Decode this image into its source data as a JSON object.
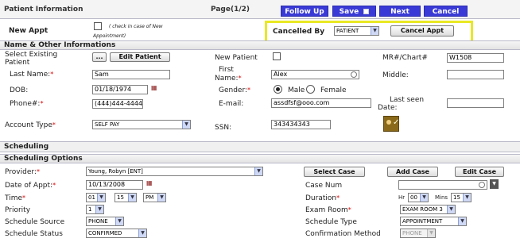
{
  "header": {
    "title": "Patient Information",
    "page": "Page(1/2)",
    "buttons": {
      "follow_up": "Follow Up",
      "save": "Save",
      "next": "Next",
      "cancel": "Cancel"
    },
    "save_icon": "floppy-icon"
  },
  "new_appt": {
    "label": "New Appt",
    "note_line1": "( check in case of New",
    "note_line2": "Appointment)"
  },
  "cancelled_by": {
    "label": "Cancelled By",
    "value": "PATIENT",
    "button": "Cancel Appt"
  },
  "sections": {
    "name_other": "Name & Other Informations",
    "scheduling": "Scheduling",
    "scheduling_options": "Scheduling Options"
  },
  "patient": {
    "select_existing_label": "Select Existing Patient",
    "dots": "...",
    "edit_patient": "Edit Patient",
    "new_patient_label": "New Patient",
    "mr_chart_label": "MR#/Chart#",
    "mr_chart_value": "W1508",
    "last_name_label": "Last Name:",
    "last_name_value": "Sam",
    "first_name_label_1": "First",
    "first_name_label_2": "Name:",
    "first_name_value": "Alex",
    "middle_label": "Middle:",
    "middle_value": "",
    "dob_label": "DOB:",
    "dob_value": "01/18/1974",
    "gender_label": "Gender:",
    "gender_male": "Male",
    "gender_female": "Female",
    "phone_label": "Phone#:",
    "phone_value": "(444)444-4444",
    "email_label": "E-mail:",
    "email_value": "assdfsf@ooo.com",
    "last_seen_label_1": "Last seen",
    "last_seen_label_2": "Date:",
    "last_seen_value": "",
    "account_type_label": "Account Type",
    "account_type_value": "SELF PAY",
    "ssn_label": "SSN:",
    "ssn_value": "343434343"
  },
  "scheduling": {
    "provider_label": "Provider:",
    "provider_value": "Young, Robyn [ENT]",
    "select_case": "Select Case",
    "add_case": "Add Case",
    "edit_case": "Edit Case",
    "date_label": "Date of Appt:",
    "date_value": "10/13/2008",
    "case_num_label": "Case Num",
    "case_num_value": "",
    "time_label": "Time",
    "time_hour": "01",
    "time_min": "15",
    "time_ampm": "PM",
    "duration_label": "Duration",
    "hr_label": "Hr",
    "hr_value": "00",
    "mins_label": "Mins",
    "mins_value": "15",
    "priority_label": "Priority",
    "priority_value": "1",
    "exam_room_label": "Exam Room",
    "exam_room_value": "EXAM ROOM 3",
    "schedule_source_label": "Schedule Source",
    "schedule_source_value": "PHONE",
    "schedule_type_label": "Schedule Type",
    "schedule_type_value": "APPOINTMENT",
    "schedule_status_label": "Schedule Status",
    "schedule_status_value": "CONFIRMED",
    "confirmation_method_label": "Confirmation Method",
    "confirmation_method_value": "PHONE"
  },
  "colors": {
    "button_blue": "#3a3bd6",
    "highlight": "#e8e825",
    "required": "#dd0000"
  }
}
